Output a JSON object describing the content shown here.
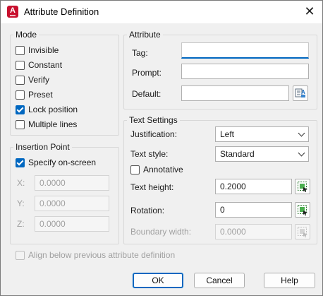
{
  "window": {
    "title": "Attribute Definition",
    "app_icon_letter": "A",
    "close_glyph": "✕"
  },
  "mode": {
    "label": "Mode",
    "options": [
      {
        "label": "Invisible",
        "checked": false
      },
      {
        "label": "Constant",
        "checked": false
      },
      {
        "label": "Verify",
        "checked": false
      },
      {
        "label": "Preset",
        "checked": false
      },
      {
        "label": "Lock position",
        "checked": true
      },
      {
        "label": "Multiple lines",
        "checked": false
      }
    ]
  },
  "insertion": {
    "label": "Insertion Point",
    "specify_label": "Specify on-screen",
    "specify_checked": true,
    "x_label": "X:",
    "x_value": "0.0000",
    "y_label": "Y:",
    "y_value": "0.0000",
    "z_label": "Z:",
    "z_value": "0.0000"
  },
  "attribute": {
    "label": "Attribute",
    "tag_label": "Tag:",
    "tag_value": "",
    "prompt_label": "Prompt:",
    "prompt_value": "",
    "default_label": "Default:",
    "default_value": ""
  },
  "text_settings": {
    "label": "Text Settings",
    "justification_label": "Justification:",
    "justification_value": "Left",
    "style_label": "Text style:",
    "style_value": "Standard",
    "annotative_label": "Annotative",
    "annotative_checked": false,
    "height_label": "Text height:",
    "height_value": "0.2000",
    "rotation_label": "Rotation:",
    "rotation_value": "0",
    "boundary_label": "Boundary width:",
    "boundary_value": "0.0000"
  },
  "align_label": "Align below previous attribute definition",
  "buttons": {
    "ok": "OK",
    "cancel": "Cancel",
    "help": "Help"
  }
}
